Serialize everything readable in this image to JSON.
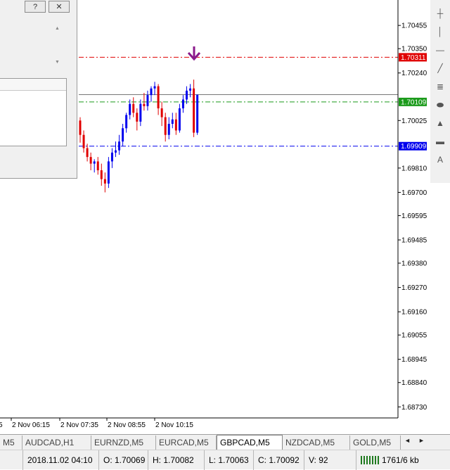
{
  "chart": {
    "bull_color": "#0000ee",
    "bear_color": "#e00000",
    "price_max": 1.7057,
    "price_min": 1.6868,
    "price_axis_labels": [
      "1.70455",
      "1.70350",
      "1.70240",
      "1.70025",
      "1.69810",
      "1.69700",
      "1.69595",
      "1.69485",
      "1.69380",
      "1.69270",
      "1.69160",
      "1.69055",
      "1.68945",
      "1.68840",
      "1.68730"
    ],
    "time_labels": [
      "5",
      "2 Nov 06:15",
      "2 Nov 07:35",
      "2 Nov 08:55",
      "2 Nov 10:15"
    ],
    "lines": [
      {
        "price": 1.70311,
        "label": "1.70311",
        "color": "#e00000",
        "style": "dashdot"
      },
      {
        "price": 1.70109,
        "label": "1.70109",
        "color": "#1a9a1a",
        "style": "dashdot"
      },
      {
        "price": 1.69909,
        "label": "1.69909",
        "color": "#0000ee",
        "style": "dashdot"
      }
    ],
    "current_price": 1.70142,
    "sell_arrow_color": "#8b1a8b",
    "candles": [
      [
        1.70025,
        1.7004,
        1.69925,
        1.6996
      ],
      [
        1.6996,
        1.6998,
        1.6988,
        1.699
      ],
      [
        1.699,
        1.6992,
        1.6984,
        1.6986
      ],
      [
        1.6986,
        1.6988,
        1.698,
        1.6983
      ],
      [
        1.6983,
        1.6985,
        1.6979,
        1.6984
      ],
      [
        1.6984,
        1.6986,
        1.6978,
        1.698
      ],
      [
        1.698,
        1.6983,
        1.6973,
        1.6976
      ],
      [
        1.6976,
        1.6979,
        1.697,
        1.6974
      ],
      [
        1.6974,
        1.6986,
        1.6972,
        1.6984
      ],
      [
        1.6984,
        1.699,
        1.6981,
        1.6988
      ],
      [
        1.6988,
        1.6993,
        1.6986,
        1.6989
      ],
      [
        1.6989,
        1.6996,
        1.6987,
        1.6993
      ],
      [
        1.6993,
        1.7001,
        1.6991,
        1.6999
      ],
      [
        1.6999,
        1.7006,
        1.6997,
        1.7005
      ],
      [
        1.7005,
        1.7012,
        1.7003,
        1.701
      ],
      [
        1.701,
        1.7013,
        1.7004,
        1.7006
      ],
      [
        1.7006,
        1.7008,
        1.6998,
        1.7002
      ],
      [
        1.7002,
        1.7012,
        1.7,
        1.701
      ],
      [
        1.701,
        1.7015,
        1.7007,
        1.7009
      ],
      [
        1.7009,
        1.7016,
        1.7007,
        1.7014
      ],
      [
        1.7014,
        1.7018,
        1.7011,
        1.7017
      ],
      [
        1.7017,
        1.702,
        1.7014,
        1.7018
      ],
      [
        1.7018,
        1.7019,
        1.7005,
        1.7008
      ],
      [
        1.7008,
        1.7011,
        1.7,
        1.7004
      ],
      [
        1.7004,
        1.7006,
        1.6993,
        1.6996
      ],
      [
        1.6996,
        1.7004,
        1.6994,
        1.7001
      ],
      [
        1.7001,
        1.7006,
        1.6999,
        1.7003
      ],
      [
        1.7003,
        1.7006,
        1.6996,
        1.6998
      ],
      [
        1.6998,
        1.701,
        1.6997,
        1.7008
      ],
      [
        1.7008,
        1.7014,
        1.7006,
        1.7012
      ],
      [
        1.7012,
        1.7018,
        1.701,
        1.7016
      ],
      [
        1.7016,
        1.7019,
        1.7013,
        1.7017
      ],
      [
        1.7017,
        1.7021,
        1.6995,
        1.6997
      ],
      [
        1.6997,
        1.70142,
        1.6996,
        1.70142
      ]
    ]
  },
  "dialog": {
    "help_label": "?",
    "close_label": "✕"
  },
  "toolbar": {
    "tools": [
      "crosshair-icon",
      "vertical-line-icon",
      "horizontal-line-icon",
      "trendline-icon",
      "fibonacci-icon",
      "ellipse-icon",
      "triangle-icon",
      "rectangle-icon",
      "text-icon"
    ]
  },
  "tabs": {
    "items": [
      {
        "label": "M5",
        "active": false
      },
      {
        "label": "AUDCAD,H1",
        "active": false
      },
      {
        "label": "EURNZD,M5",
        "active": false
      },
      {
        "label": "EURCAD,M5",
        "active": false
      },
      {
        "label": "GBPCAD,M5",
        "active": true
      },
      {
        "label": "NZDCAD,M5",
        "active": false
      },
      {
        "label": "GOLD,M5",
        "active": false
      }
    ],
    "left_arrow": "◄",
    "right_arrow": "►"
  },
  "status": {
    "datetime": "2018.11.02 04:10",
    "open": "O: 1.70069",
    "high": "H: 1.70082",
    "low": "L: 1.70063",
    "close": "C: 1.70092",
    "volume": "V: 92",
    "traffic": "1761/6 kb"
  }
}
